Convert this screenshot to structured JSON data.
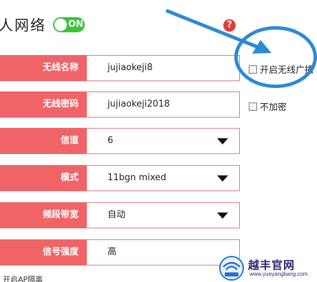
{
  "header": {
    "title": "人网络",
    "toggle_label": "ON",
    "help_glyph": "?"
  },
  "form": {
    "rows": [
      {
        "label": "无线名称",
        "value": "jujiaokeji8"
      },
      {
        "label": "无线密码",
        "value": "jujiaokeji2018"
      },
      {
        "label": "信道",
        "value": "6"
      },
      {
        "label": "模式",
        "value": "11bgn mixed"
      },
      {
        "label": "频段带宽",
        "value": "自动"
      },
      {
        "label": "信号强度",
        "value": "高"
      }
    ]
  },
  "checkboxes": {
    "broadcast": {
      "label": "开启无线广播",
      "checked": false
    },
    "no_encrypt": {
      "label": "不加密",
      "checked": false
    }
  },
  "bottom": {
    "partial_text": "开启AP隔离"
  },
  "watermark": {
    "title": "越丰官网",
    "url": "www.yueyangbang.com"
  },
  "colors": {
    "label_bg": "#f06468",
    "toggle_on": "#3cc43a",
    "annotation": "#2b8ad6",
    "help": "#e23b3b"
  }
}
